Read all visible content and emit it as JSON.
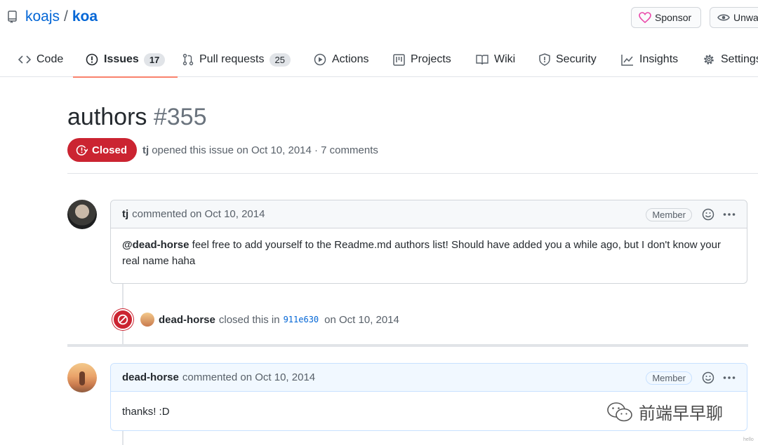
{
  "repo": {
    "owner": "koajs",
    "separator": "/",
    "name": "koa"
  },
  "header_buttons": {
    "sponsor": "Sponsor",
    "watch": "Unwatch"
  },
  "tabs": [
    {
      "label": "Code",
      "icon": "code-icon"
    },
    {
      "label": "Issues",
      "icon": "issue-icon",
      "count": "17",
      "selected": true
    },
    {
      "label": "Pull requests",
      "icon": "pull-request-icon",
      "count": "25"
    },
    {
      "label": "Actions",
      "icon": "play-icon"
    },
    {
      "label": "Projects",
      "icon": "project-icon"
    },
    {
      "label": "Wiki",
      "icon": "book-icon"
    },
    {
      "label": "Security",
      "icon": "shield-icon"
    },
    {
      "label": "Insights",
      "icon": "graph-icon"
    },
    {
      "label": "Settings",
      "icon": "gear-icon"
    }
  ],
  "issue": {
    "title": "authors",
    "number": "#355",
    "state": "Closed",
    "author": "tj",
    "meta": "opened this issue on Oct 10, 2014 · 7 comments"
  },
  "comments": [
    {
      "author": "tj",
      "meta": "commented on Oct 10, 2014",
      "badge": "Member",
      "mention": "@dead-horse",
      "body": " feel free to add yourself to the Readme.md authors list! Should have added you a while ago, but I don't know your real name haha"
    },
    {
      "author": "dead-horse",
      "meta": "commented on Oct 10, 2014",
      "badge": "Member",
      "body": "thanks! :D"
    }
  ],
  "event": {
    "actor": "dead-horse",
    "action": "closed this in",
    "commit": "911e630",
    "date": "on Oct 10, 2014"
  },
  "watermark": {
    "text": "前端早早聊",
    "small": "hello"
  },
  "colors": {
    "link": "#0366d6",
    "closed": "#cb2431",
    "tab_underline": "#f9826c"
  }
}
